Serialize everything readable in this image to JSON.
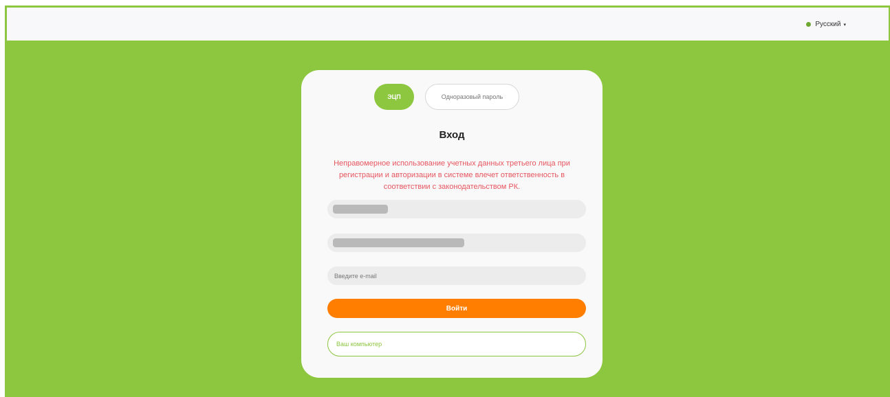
{
  "header": {
    "language": {
      "label": "Русский",
      "icon": "globe-icon",
      "caret": "▾"
    }
  },
  "login": {
    "tabs": [
      {
        "label": "ЭЦП",
        "active": true
      },
      {
        "label": "Одноразовый пароль",
        "active": false
      }
    ],
    "title": "Вход",
    "warning": "Неправомерное использование учетных данных третьего лица при регистрации и авторизации в системе влечет ответственность в соответствии с законодательством РК.",
    "fields": {
      "email_placeholder": "Введите e-mail",
      "computer_placeholder": "Ваш компьютер"
    },
    "submit_label": "Войти"
  },
  "colors": {
    "brand_green": "#8dc63f",
    "button_orange": "#ff7e00",
    "warning_red": "#e6555f"
  }
}
